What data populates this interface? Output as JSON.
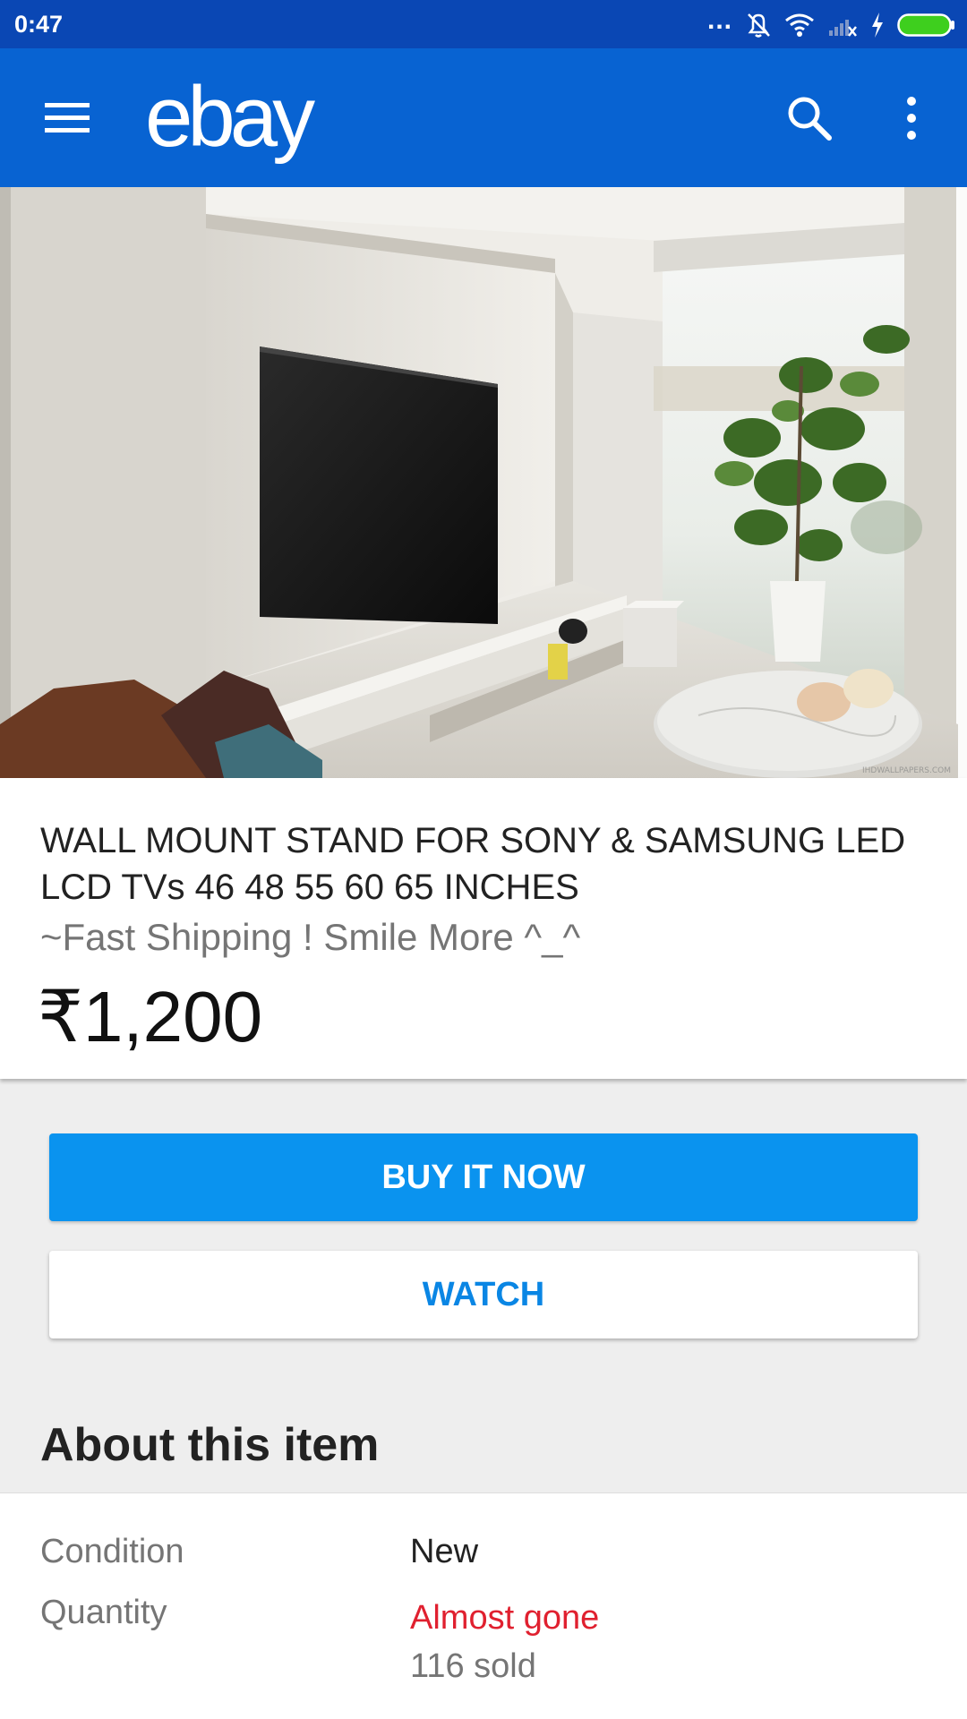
{
  "status_bar": {
    "time": "0:47",
    "dots": "...",
    "icons": [
      "notifications-off-icon",
      "wifi-icon",
      "signal-icon",
      "charging-icon",
      "battery-icon"
    ],
    "battery_color": "#3ecf1e"
  },
  "app_bar": {
    "logo": "ebay",
    "icons": [
      "menu-icon",
      "search-icon",
      "more-vert-icon"
    ],
    "background": "#0863d2"
  },
  "hero_image": {
    "description_icon": "product-photo",
    "watermark": "IHDWALLPAPERS.COM"
  },
  "item": {
    "title": "WALL MOUNT STAND FOR SONY & SAMSUNG LED LCD TVs 46 48 55 60 65 INCHES",
    "subtitle": "~Fast Shipping ! Smile More ^_^",
    "price": "₹1,200"
  },
  "actions": {
    "buy_label": "BUY IT NOW",
    "watch_label": "WATCH",
    "buy_color": "#0a93ef"
  },
  "about": {
    "heading": "About this item",
    "specs": [
      {
        "label": "Condition",
        "value": "New"
      },
      {
        "label": "Quantity",
        "value": "Almost gone",
        "sub": "116 sold"
      }
    ]
  }
}
